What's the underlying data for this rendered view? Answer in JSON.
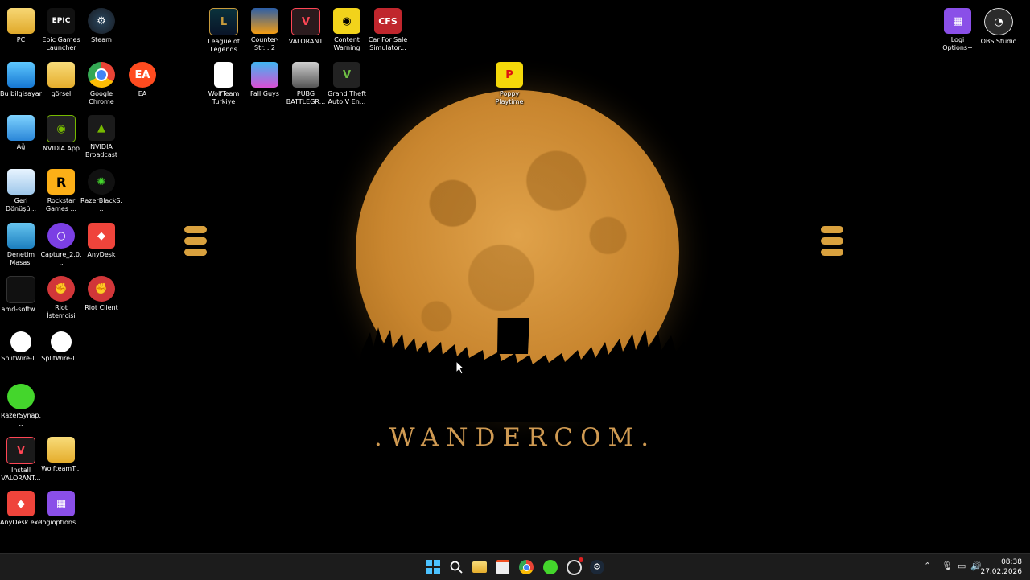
{
  "wallpaper": {
    "wordmark": ".WANDERCOM."
  },
  "desktop_icons": {
    "pc": "PC",
    "epic": "Epic Games Launcher",
    "steam": "Steam",
    "lol": "League of Legends",
    "cs2": "Counter-Str... 2",
    "valorant": "VALORANT",
    "content_warning": "Content Warning",
    "cfs": "Car For Sale Simulator...",
    "logi_options": "Logi Options+",
    "obs": "OBS Studio",
    "bu_bilgisayar": "Bu bilgisayar",
    "gorsel": "görsel",
    "chrome": "Google Chrome",
    "ea": "EA",
    "wolfteam": "WolfTeam Turkiye",
    "fall_guys": "Fall Guys",
    "pubg": "PUBG BATTLEGR...",
    "gta": "Grand Theft Auto V En...",
    "poppy": "Poppy Playtime",
    "ag": "Ağ",
    "nvidia_app": "NVIDIA App",
    "nvidia_broadcast": "NVIDIA Broadcast",
    "geri_donusum": "Geri Dönüşü...",
    "rockstar": "Rockstar Games ...",
    "razer_blacks": "RazerBlackS...",
    "denetim": "Denetim Masası",
    "capture": "Capture_2.0...",
    "anydesk": "AnyDesk",
    "amd": "amd-softw...",
    "riot_istemci": "Riot İstemcisi",
    "riot_client": "Riot Client",
    "splitwire1": "SplitWire-T...",
    "splitwire2": "SplitWire-T...",
    "razer_synapse": "RazerSynap...",
    "install_valorant": "Install VALORANT...",
    "wolfteam_folder": "WolfteamT...",
    "anydesk_exe": "AnyDesk.exe",
    "logioptions": "logioptions..."
  },
  "icon_glyphs": {
    "epic": "EPIC",
    "cfs": "CFS",
    "ea": "EA",
    "rockstar": "R",
    "lol": "L"
  },
  "taskbar": {
    "time": "08:38",
    "date": "27.02.2026"
  },
  "colors": {
    "moon": "#c9862f",
    "wordmark": "#cf9a52",
    "taskbar": "#1c1c1c",
    "accent": "#0078d4"
  }
}
